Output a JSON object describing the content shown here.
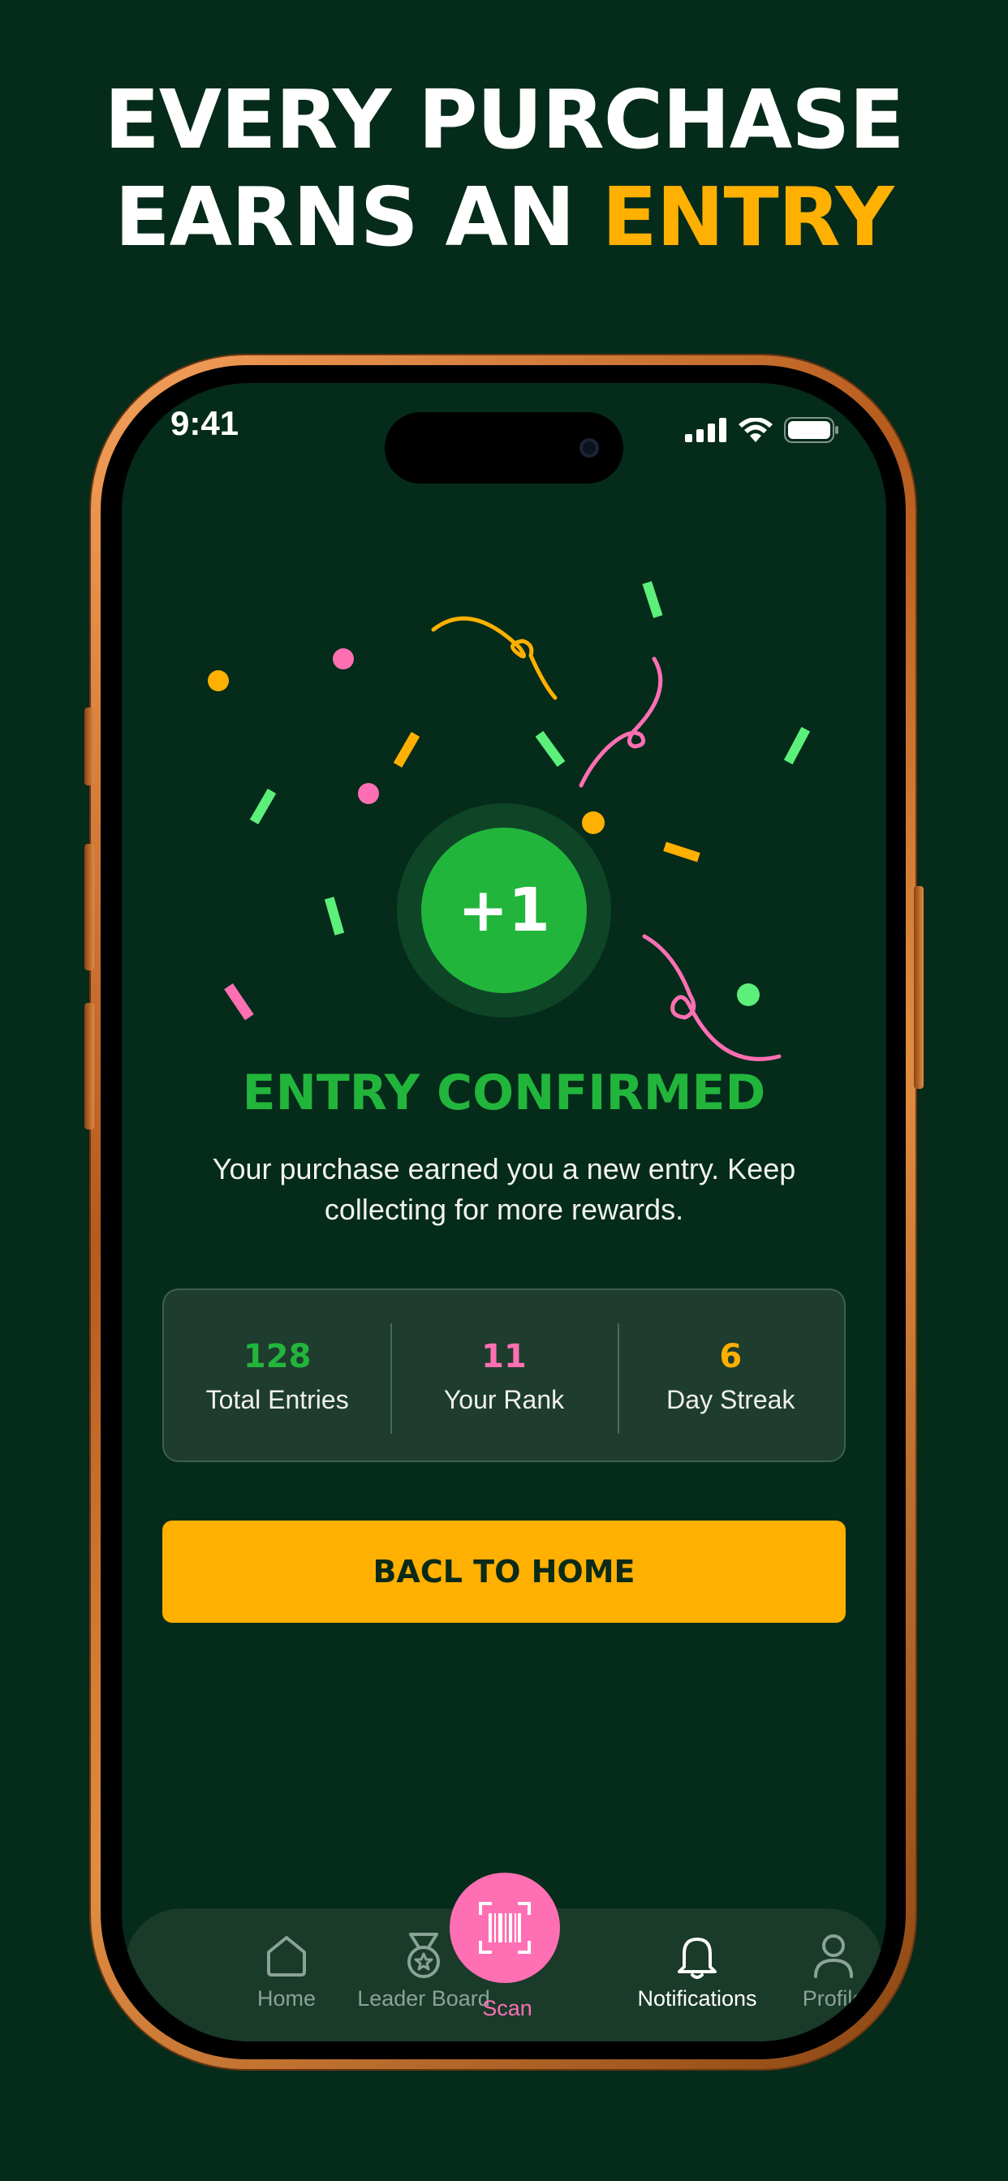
{
  "headline": {
    "line1": "EVERY PURCHASE",
    "line2_prefix": "EARNS AN",
    "line2_accent": "ENTRY"
  },
  "status_bar": {
    "time": "9:41",
    "icons": [
      "signal-icon",
      "wifi-icon",
      "battery-icon"
    ]
  },
  "badge": {
    "text": "+1"
  },
  "confirmation": {
    "title": "ENTRY CONFIRMED",
    "message": "Your purchase earned you a new entry. Keep collecting for more rewards."
  },
  "stats": [
    {
      "value": "128",
      "label": "Total Entries",
      "color": "#22b53c"
    },
    {
      "value": "11",
      "label": "Your Rank",
      "color": "#ff6fb3"
    },
    {
      "value": "6",
      "label": "Day Streak",
      "color": "#ffb000"
    }
  ],
  "cta": {
    "label": "BACL TO HOME"
  },
  "tabbar": {
    "home": "Home",
    "leaderboard": "Leader Board",
    "scan": "Scan",
    "notifications": "Notifications",
    "profile": "Profile"
  },
  "colors": {
    "background": "#052b1a",
    "accent_yellow": "#ffb000",
    "accent_green": "#22b53c",
    "accent_pink": "#ff6fb3",
    "frame": "#c26a2a"
  }
}
